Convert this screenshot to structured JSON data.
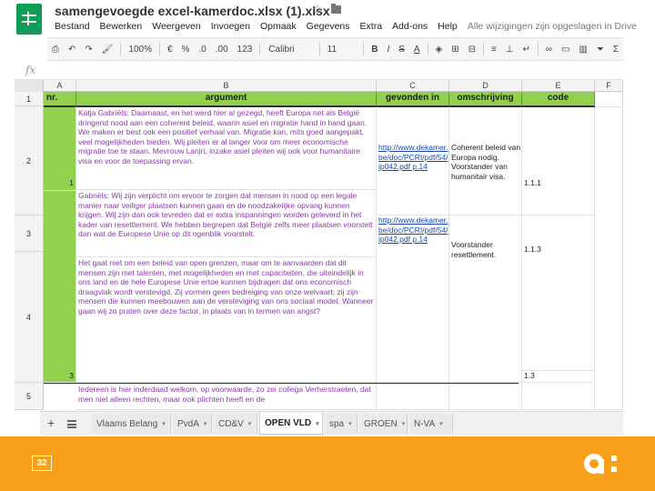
{
  "app": {
    "title": "samengevoegde excel-kamerdoc.xlsx (1).xlsx",
    "star_glyph": "☆",
    "menus": [
      "Bestand",
      "Bewerken",
      "Weergeven",
      "Invoegen",
      "Opmaak",
      "Gegevens",
      "Extra",
      "Add-ons",
      "Help"
    ],
    "save_status": "Alle wijzigingen zijn opgeslagen in Drive"
  },
  "toolbar": {
    "zoom": "100%",
    "currency": "€",
    "percent": "%",
    "decimals_less": ".0",
    "decimals_more": ".00",
    "number_format": "123",
    "font": "Calibri",
    "font_size": "11",
    "bold": "B",
    "italic": "I",
    "strike": "S",
    "text_color": "A"
  },
  "formula_bar": {
    "fx": "fx",
    "value": ""
  },
  "columns": [
    {
      "id": "A",
      "label": ""
    },
    {
      "id": "B",
      "label": "B"
    },
    {
      "id": "C",
      "label": "C"
    },
    {
      "id": "D",
      "label": "D"
    },
    {
      "id": "E",
      "label": "E"
    },
    {
      "id": "F",
      "label": "F"
    }
  ],
  "rows": [
    "1",
    "2",
    "3",
    "4",
    "5"
  ],
  "header_row": {
    "nr": "nr.",
    "argument": "argument",
    "gevonden_in": "gevonden in",
    "omschrijving": "omschrijving",
    "code": "code"
  },
  "data_rows": [
    {
      "nr": "1",
      "argument": "Katja Gabriëls: Daarnaast, en het werd hier al gezegd, heeft Europa net als België dringend nood aan een coherent beleid, waarin asiel en migratie hand in hand gaan. We maken er best ook een positief verhaal van. Migratie kan, mits goed aangepakt, veel mogelijkheden bieden. Wij pleiten er al langer voor om meer economische migratie toe te staan. Mevrouw Lanjri, inzake asiel pleiten wij ook voor humanitaire visa en voor de toepassing ervan.",
      "gevonden_in": "http://www.dekamer.be/doc/PCRI/pdf/54/ip042.pdf p.14",
      "omschrijving": "Coherent beleid van Europa nodig. Voorstander van humanitair visa.",
      "code": "1.1.1"
    },
    {
      "nr": "2",
      "argument": "Gabriëls: Wij zijn verplicht om ervoor te zorgen dat mensen in nood op een legale manier naar veiliger plaatsen kunnen gaan en de noodzakelijke opvang kunnen krijgen. Wij zijn dan ook tevreden dat er extra inspanningen worden geleverd in het kader van resettlement. We hebben begrepen dat België zelfs meer plaatsen voorstelt dan wat de Europese Unie op dit ogenblik voorstelt.",
      "gevonden_in": "http://www.dekamer.be/doc/PCRI/pdf/54/ip042.pdf p.14",
      "omschrijving": "Voorstander resettlement.",
      "code": "1.1.3"
    },
    {
      "nr": "3",
      "argument": "Het gaat niet om een beleid van open grenzen, maar om te aanvaarden dat dit mensen zijn met talenten, met mogelijkheden en met capaciteiten, die uiteindelijk in ons land en de hele Europese Unie ertoe kunnen bijdragen dat ons economisch draagvlak wordt verstevigd. Zij vormen geen bedreiging van onze welvaart; zij zijn mensen die kunnen meebouwen aan de versteviging van ons sociaal model. Wanneer gaan wij zo praten over deze factor, in plaats van in termen van angst?",
      "gevonden_in": "",
      "omschrijving": "",
      "code": "1.3"
    },
    {
      "nr": "",
      "argument": "Iedereen is hier inderdaad welkom, op voorwaarde, zo zei collega Verherstraeten, dat men niet alleen rechten, maar ook plichten heeft en de",
      "gevonden_in": "",
      "omschrijving": "",
      "code": ""
    }
  ],
  "sheets": {
    "add_glyph": "+",
    "tabs": [
      {
        "label": "Vlaams Belang",
        "active": false
      },
      {
        "label": "PvdA",
        "active": false
      },
      {
        "label": "CD&V",
        "active": false
      },
      {
        "label": "OPEN VLD",
        "active": true
      },
      {
        "label": "spa",
        "active": false
      },
      {
        "label": "GROEN",
        "active": false
      },
      {
        "label": "N-VA",
        "active": false
      }
    ],
    "caret": "▾"
  },
  "footer": {
    "page_number": "32"
  },
  "colors": {
    "accent_green": "#0f9d58",
    "header_green": "#92d050",
    "footer_orange": "#f7a11a",
    "argument_text": "#8b3aa8",
    "link_blue": "#1a4aa6"
  }
}
